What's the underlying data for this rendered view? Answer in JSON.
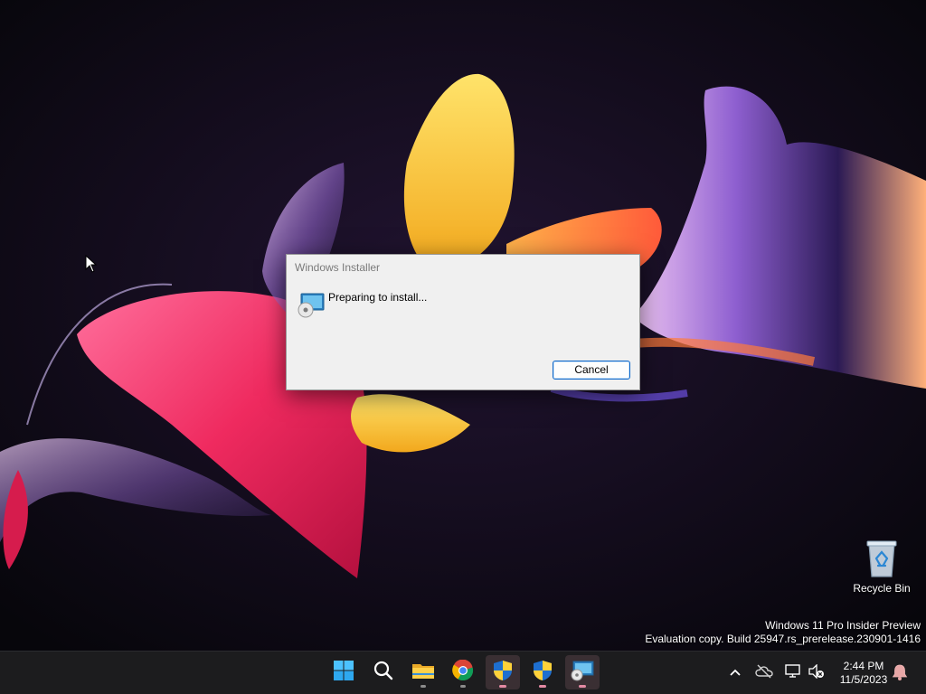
{
  "dialog": {
    "title": "Windows Installer",
    "message": "Preparing to install...",
    "cancel_label": "Cancel",
    "icon": "installer-icon"
  },
  "desktop": {
    "recycle_bin_label": "Recycle Bin",
    "watermark_line1": "Windows 11 Pro Insider Preview",
    "watermark_line2": "Evaluation copy. Build 25947.rs_prerelease.230901-1416"
  },
  "taskbar": {
    "apps": [
      {
        "name": "start",
        "icon": "windows-logo-icon"
      },
      {
        "name": "search",
        "icon": "search-icon"
      },
      {
        "name": "file-explorer",
        "icon": "folder-icon"
      },
      {
        "name": "chrome",
        "icon": "chrome-icon"
      },
      {
        "name": "uac-shield-1",
        "icon": "shield-icon"
      },
      {
        "name": "uac-shield-2",
        "icon": "shield-icon"
      },
      {
        "name": "windows-installer",
        "icon": "installer-icon"
      }
    ],
    "tray": {
      "time": "2:44 PM",
      "date": "11/5/2023"
    }
  },
  "colors": {
    "taskbar_bg": "#1c1c1e",
    "dialog_bg": "#f0f0f0",
    "button_border": "#0a64c8",
    "active_indicator": "#e58aa4"
  }
}
